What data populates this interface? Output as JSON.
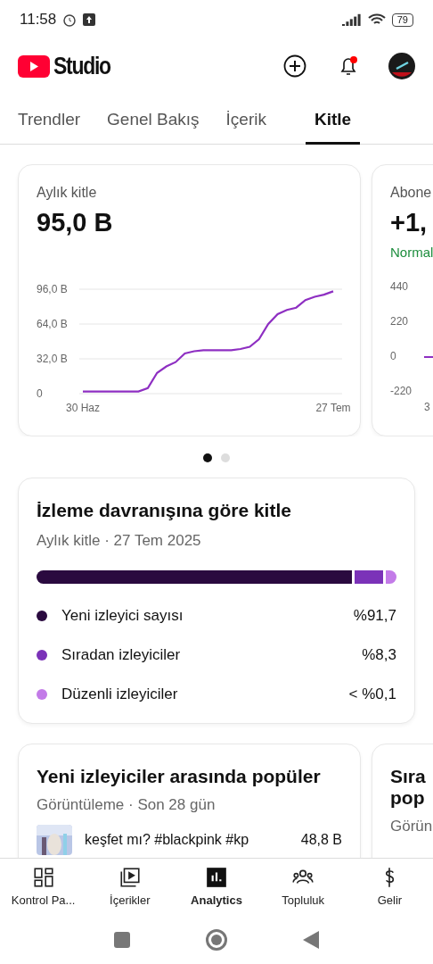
{
  "status_bar": {
    "time": "11:58",
    "battery": "79"
  },
  "header": {
    "logo": "Studio",
    "notification_dot": true
  },
  "tabs": [
    {
      "label": "Trendler",
      "selected": false
    },
    {
      "label": "Genel Bakış",
      "selected": false
    },
    {
      "label": "İçerik",
      "selected": false
    },
    {
      "label": "Kitle",
      "selected": true
    }
  ],
  "metric_cards": [
    {
      "title": "Aylık kitle",
      "value": "95,0 B",
      "chart_data": {
        "type": "line",
        "categories": [
          "30 Haz",
          null,
          null,
          null,
          null,
          null,
          null,
          null,
          null,
          null,
          null,
          null,
          null,
          null,
          null,
          null,
          null,
          null,
          null,
          null,
          null,
          null,
          null,
          null,
          null,
          null,
          null,
          "27 Tem"
        ],
        "ylim": [
          0,
          96
        ],
        "yticks": [
          {
            "value": 0,
            "label": "0"
          },
          {
            "value": 32,
            "label": "32,0 B"
          },
          {
            "value": 64,
            "label": "64,0 B"
          },
          {
            "value": 96,
            "label": "96,0 B"
          }
        ],
        "series": [
          {
            "color": "#8e2fc2",
            "values": [
              2,
              2,
              2,
              2,
              2,
              2,
              2,
              5,
              19,
              25,
              29,
              37,
              39,
              40,
              40,
              40,
              40,
              41,
              43,
              50,
              64,
              73,
              77,
              79,
              86,
              89,
              91,
              94
            ]
          }
        ]
      }
    },
    {
      "title": "Abone",
      "value": "+1,",
      "note": "Normal",
      "axis_labels": [
        "440",
        "220",
        "0",
        "-220"
      ],
      "x_label": "3"
    }
  ],
  "page_dots": [
    {
      "selected": true
    },
    {
      "selected": false
    }
  ],
  "behavior_card": {
    "title": "İzleme davranışına göre kitle",
    "subtitle": "Aylık kitle · 27 Tem 2025",
    "segments": [
      {
        "label": "Yeni izleyici sayısı",
        "value": "%91,7",
        "color": "#2a0a3f"
      },
      {
        "label": "Sıradan izleyiciler",
        "value": "%8,3",
        "color": "#7b32b8"
      },
      {
        "label": "Düzenli izleyiciler",
        "value": "< %0,1",
        "color": "#c37be8"
      }
    ]
  },
  "popular_cards": [
    {
      "title": "Yeni izleyiciler arasında popüler",
      "subtitle": "Görüntüleme · Son 28 gün",
      "row": {
        "title": "keşfet mı? #blackpink #kp",
        "value": "48,8 B"
      }
    },
    {
      "title": "Sıra",
      "title_line2": "pop",
      "subtitle": "Görün"
    }
  ],
  "bottom_nav": [
    {
      "label": "Kontrol Pa...",
      "selected": false
    },
    {
      "label": "İçerikler",
      "selected": false
    },
    {
      "label": "Analytics",
      "selected": true
    },
    {
      "label": "Topluluk",
      "selected": false
    },
    {
      "label": "Gelir",
      "selected": false
    }
  ]
}
